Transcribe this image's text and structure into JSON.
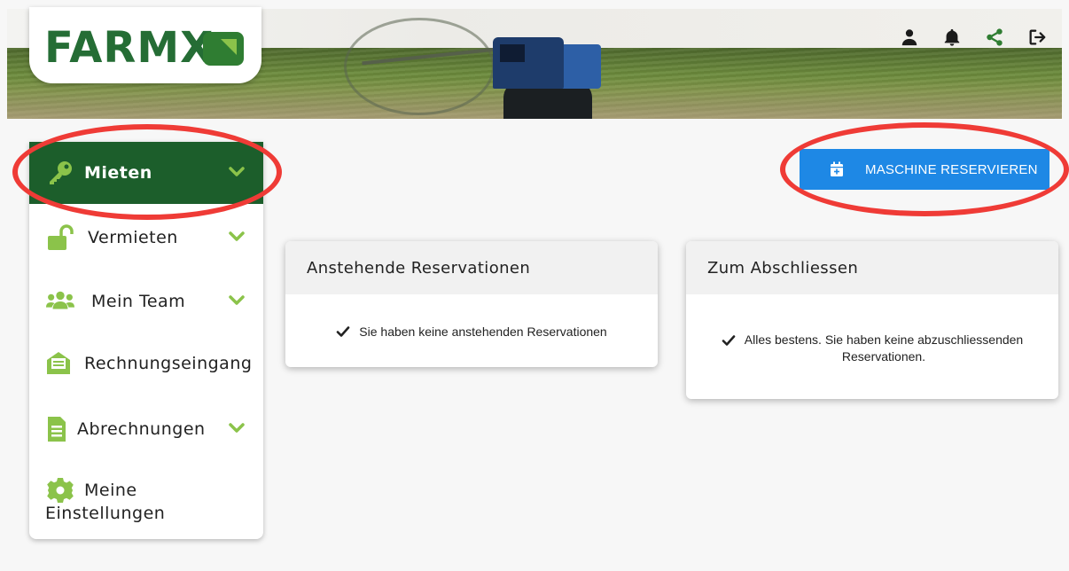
{
  "app": {
    "logo_text": "FARMX"
  },
  "header": {
    "icons": [
      "user-icon",
      "bell-icon",
      "share-icon",
      "logout-icon"
    ]
  },
  "sidebar": {
    "items": [
      {
        "label": "Mieten",
        "icon": "key-icon",
        "has_chevron": true,
        "active": true
      },
      {
        "label": "Vermieten",
        "icon": "unlock-icon",
        "has_chevron": true,
        "active": false
      },
      {
        "label": "Mein Team",
        "icon": "team-icon",
        "has_chevron": true,
        "active": false
      },
      {
        "label": "Rechnungseingang",
        "icon": "inbox-icon",
        "has_chevron": false,
        "active": false
      },
      {
        "label": "Abrechnungen",
        "icon": "document-icon",
        "has_chevron": true,
        "active": false
      },
      {
        "label": "Meine Einstellungen",
        "label_line1": "Meine",
        "label_line2": "Einstellungen",
        "icon": "gear-icon",
        "has_chevron": false,
        "active": false
      }
    ]
  },
  "actions": {
    "reserve_label": "MASCHINE RESERVIEREN",
    "reserve_icon": "calendar-plus-icon"
  },
  "cards": {
    "pending": {
      "title": "Anstehende Reservationen",
      "message": "Sie haben keine anstehenden Reservationen"
    },
    "to_close": {
      "title": "Zum Abschliessen",
      "message_line1": "Alles bestens. Sie haben keine abzuschliessenden",
      "message_line2": "Reservationen."
    }
  },
  "colors": {
    "brand_green": "#1c5e2b",
    "accent_green": "#8bc34a",
    "button_blue": "#1e88e5",
    "annotation_red": "#ef3b36"
  }
}
